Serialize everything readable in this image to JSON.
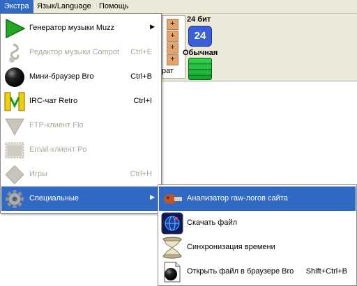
{
  "menubar": {
    "items": [
      "Экстра",
      "Язык/Language",
      "Помощь"
    ],
    "active_index": 0
  },
  "toolbar": {
    "plus_buttons": [
      "+",
      "+",
      "+",
      "+"
    ],
    "partial_label": "рат",
    "bits_label": "24 бит",
    "bits_badge": "24",
    "normal_label": "Обычная"
  },
  "menu": {
    "items": [
      {
        "label": "Генератор музыки Muzz",
        "shortcut": "",
        "submenu": true,
        "disabled": false,
        "icon": "play-triangle-icon"
      },
      {
        "label": "Редактор музыки Compot",
        "shortcut": "Ctrl+E",
        "submenu": false,
        "disabled": true,
        "icon": "music-note-icon"
      },
      {
        "label": "Мини-браузер Bro",
        "shortcut": "Ctrl+B",
        "submenu": false,
        "disabled": false,
        "icon": "black-ball-icon"
      },
      {
        "label": "IRC-чат Retro",
        "shortcut": "Ctrl+I",
        "submenu": false,
        "disabled": false,
        "icon": "irc-chat-icon"
      },
      {
        "label": "FTP-клиент Flo",
        "shortcut": "",
        "submenu": false,
        "disabled": true,
        "icon": "ftp-icon"
      },
      {
        "label": "Email-клиент Po",
        "shortcut": "",
        "submenu": false,
        "disabled": true,
        "icon": "email-icon"
      },
      {
        "label": "Игры",
        "shortcut": "Ctrl+H",
        "submenu": false,
        "disabled": true,
        "icon": "games-diamond-icon"
      },
      {
        "label": "Специальные",
        "shortcut": "",
        "submenu": true,
        "disabled": false,
        "icon": "gear-icon",
        "highlighted": true
      }
    ]
  },
  "submenu": {
    "items": [
      {
        "label": "Анализатор raw-логов сайта",
        "shortcut": "",
        "icon": "log-analyzer-icon",
        "highlighted": true
      },
      {
        "label": "Скачать файл",
        "shortcut": "",
        "icon": "download-globe-icon"
      },
      {
        "label": "Синхронизация времени",
        "shortcut": "",
        "icon": "hourglass-icon"
      },
      {
        "label": "Открыть файл в браузере Bro",
        "shortcut": "Shift+Ctrl+B",
        "icon": "file-ball-icon"
      }
    ]
  },
  "colors": {
    "highlight": "#316ac5",
    "menu_bg": "#ffffff",
    "toolbar_bg": "#ece9d8",
    "disabled_text": "#aca899"
  }
}
